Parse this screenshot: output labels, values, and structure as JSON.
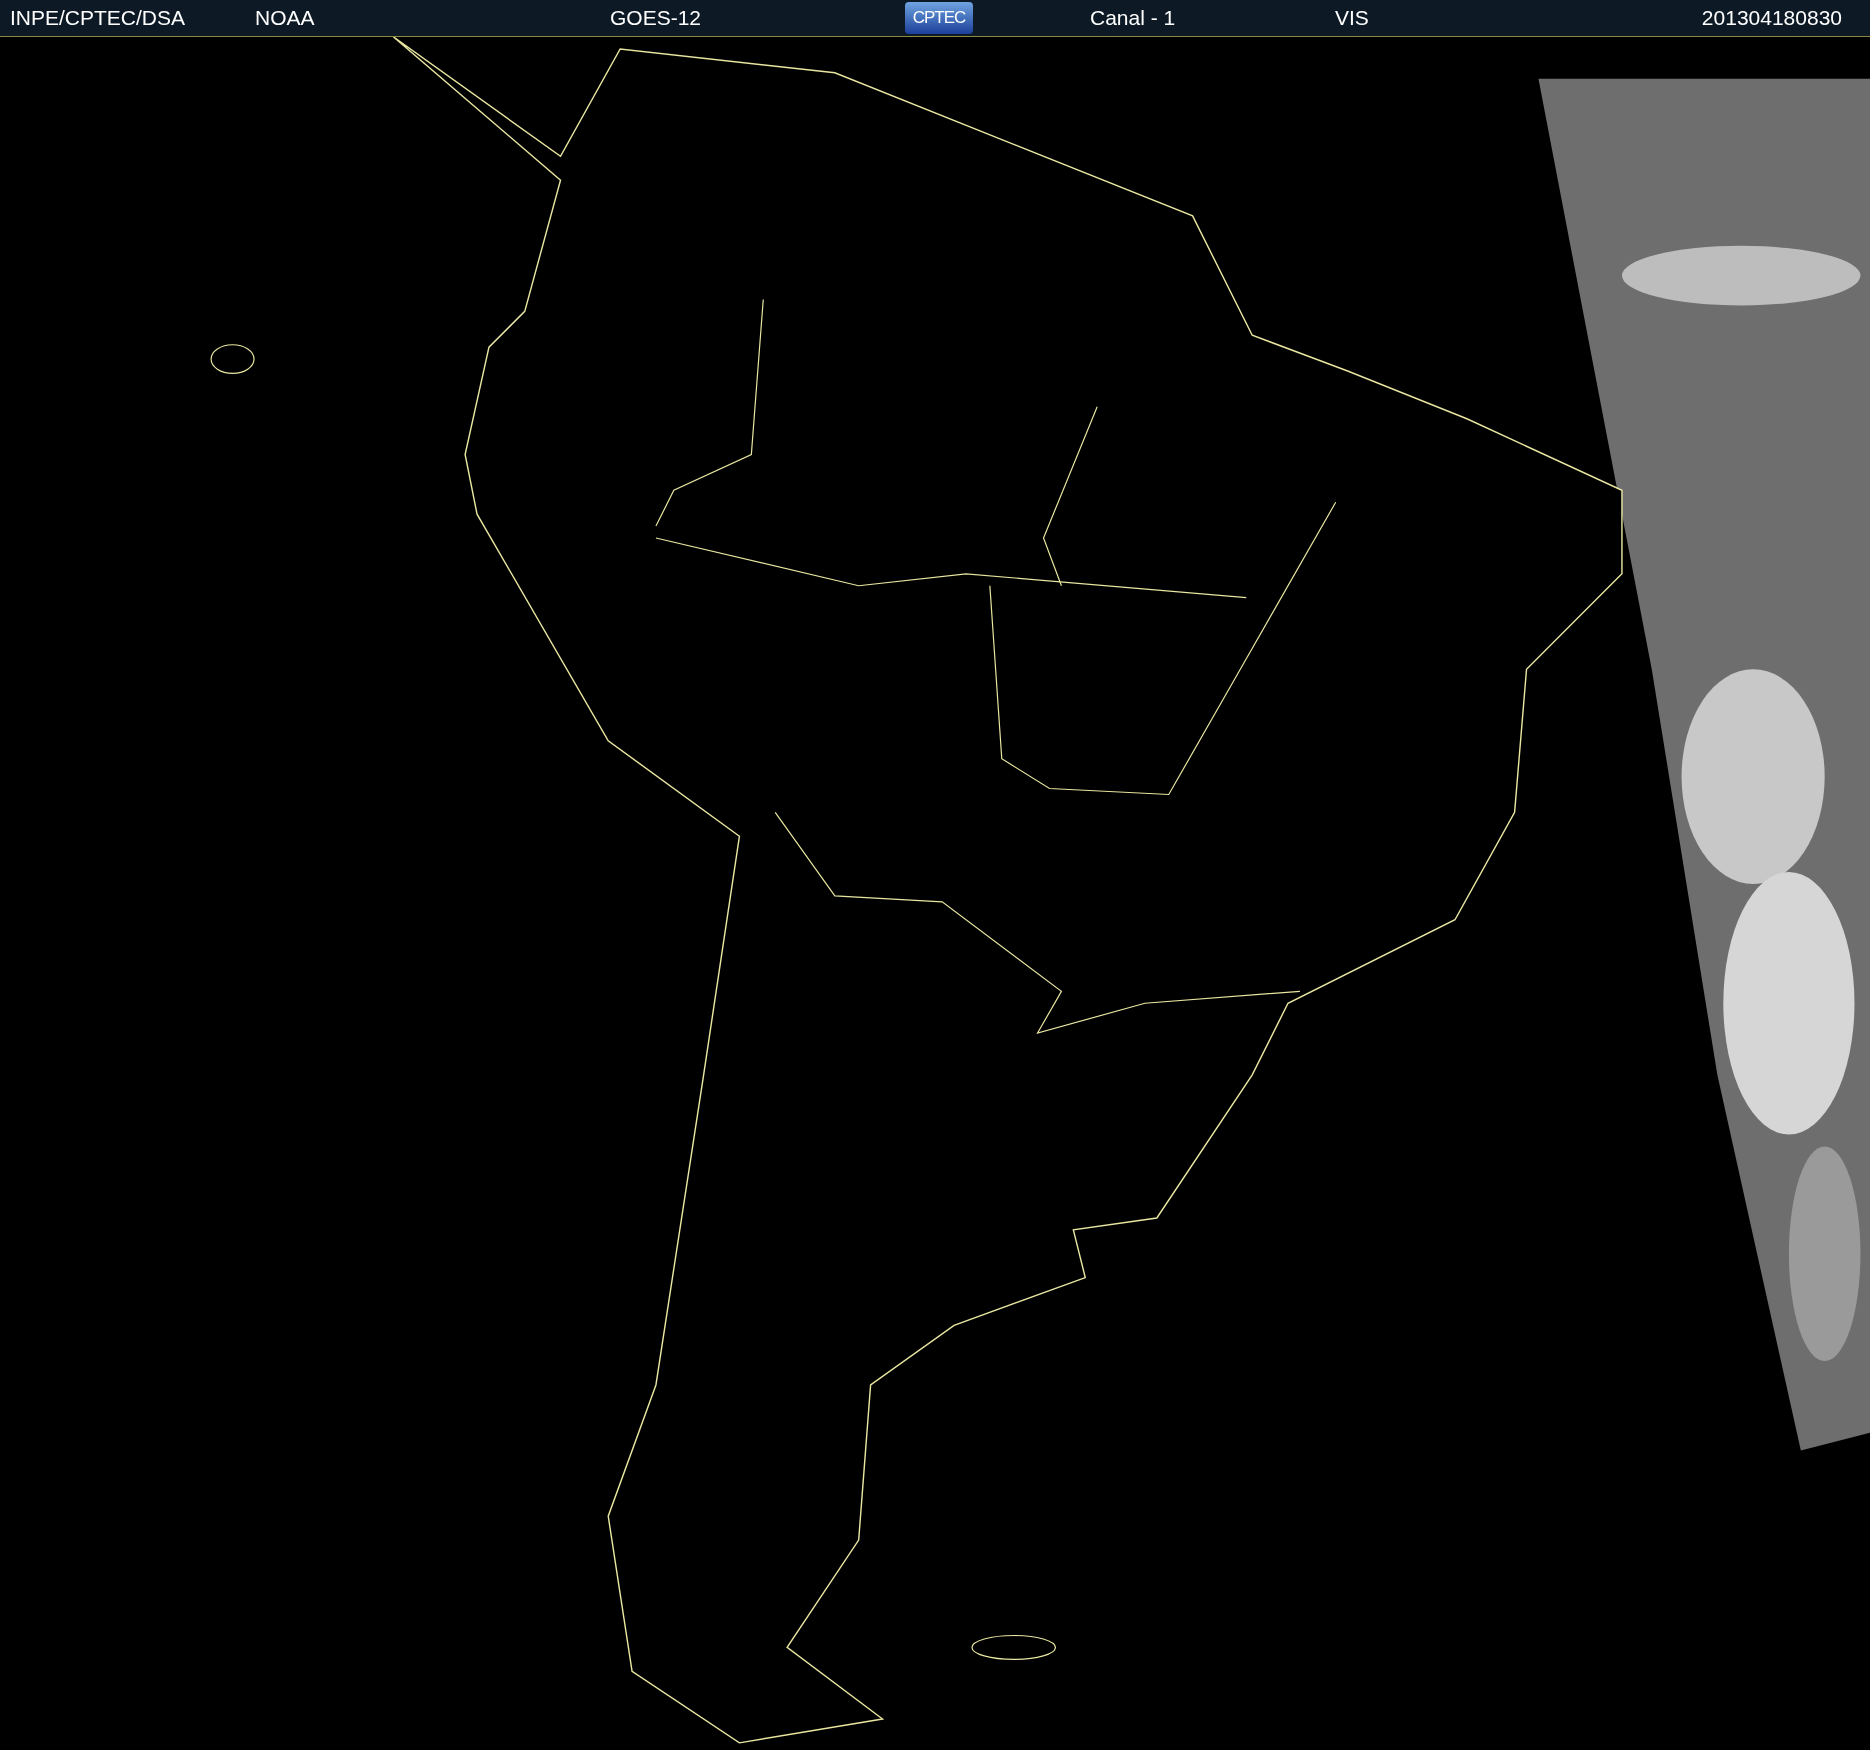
{
  "header": {
    "source": "INPE/CPTEC/DSA",
    "agency": "NOAA",
    "satellite": "GOES-12",
    "logo": "CPTEC",
    "channel": "Canal - 1",
    "band": "VIS",
    "timestamp": "201304180830"
  }
}
